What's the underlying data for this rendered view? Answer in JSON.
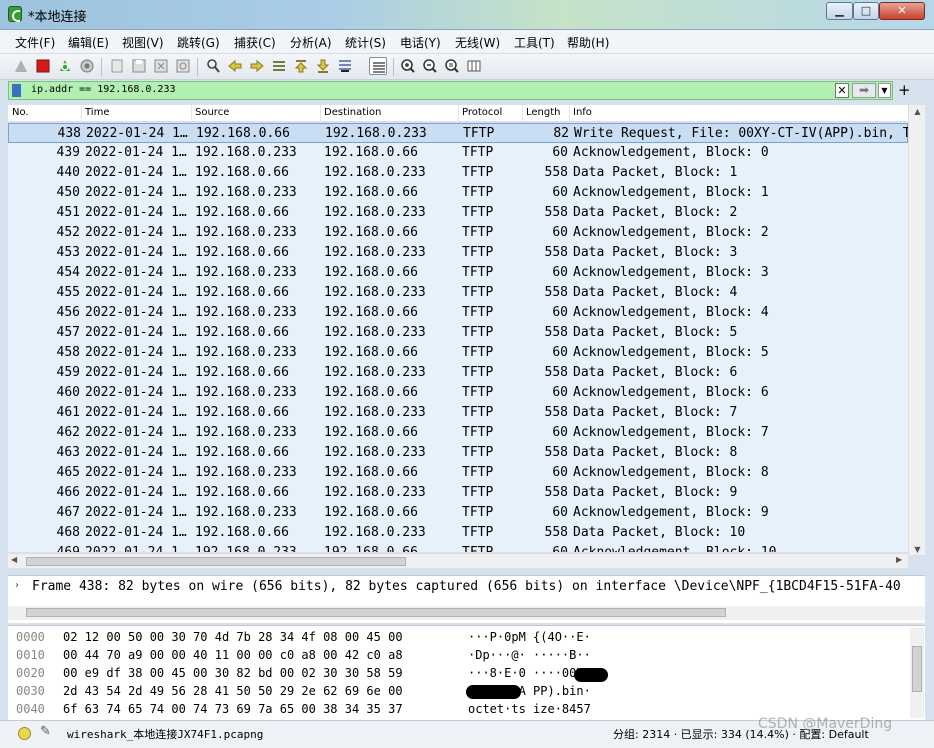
{
  "window": {
    "title": "*本地连接",
    "min": "▁",
    "max": "□",
    "close": "✕"
  },
  "menu": [
    "文件(F)",
    "编辑(E)",
    "视图(V)",
    "跳转(G)",
    "捕获(C)",
    "分析(A)",
    "统计(S)",
    "电话(Y)",
    "无线(W)",
    "工具(T)",
    "帮助(H)"
  ],
  "filter": {
    "text": "ip.addr == 192.168.0.233",
    "clear": "✕",
    "apply": "➡",
    "dropdown": "▼",
    "add": "+"
  },
  "columns": [
    "No.",
    "Time",
    "Source",
    "Destination",
    "Protocol",
    "Length",
    "Info"
  ],
  "packets": [
    {
      "no": "438",
      "time": "2022-01-24 1…",
      "src": "192.168.0.66",
      "dst": "192.168.0.233",
      "proto": "TFTP",
      "len": "82",
      "info": "Write Request, File: 00XY-CT-IV(APP).bin, T"
    },
    {
      "no": "439",
      "time": "2022-01-24 1…",
      "src": "192.168.0.233",
      "dst": "192.168.0.66",
      "proto": "TFTP",
      "len": "60",
      "info": "Acknowledgement, Block: 0"
    },
    {
      "no": "440",
      "time": "2022-01-24 1…",
      "src": "192.168.0.66",
      "dst": "192.168.0.233",
      "proto": "TFTP",
      "len": "558",
      "info": "Data Packet, Block: 1"
    },
    {
      "no": "450",
      "time": "2022-01-24 1…",
      "src": "192.168.0.233",
      "dst": "192.168.0.66",
      "proto": "TFTP",
      "len": "60",
      "info": "Acknowledgement, Block: 1"
    },
    {
      "no": "451",
      "time": "2022-01-24 1…",
      "src": "192.168.0.66",
      "dst": "192.168.0.233",
      "proto": "TFTP",
      "len": "558",
      "info": "Data Packet, Block: 2"
    },
    {
      "no": "452",
      "time": "2022-01-24 1…",
      "src": "192.168.0.233",
      "dst": "192.168.0.66",
      "proto": "TFTP",
      "len": "60",
      "info": "Acknowledgement, Block: 2"
    },
    {
      "no": "453",
      "time": "2022-01-24 1…",
      "src": "192.168.0.66",
      "dst": "192.168.0.233",
      "proto": "TFTP",
      "len": "558",
      "info": "Data Packet, Block: 3"
    },
    {
      "no": "454",
      "time": "2022-01-24 1…",
      "src": "192.168.0.233",
      "dst": "192.168.0.66",
      "proto": "TFTP",
      "len": "60",
      "info": "Acknowledgement, Block: 3"
    },
    {
      "no": "455",
      "time": "2022-01-24 1…",
      "src": "192.168.0.66",
      "dst": "192.168.0.233",
      "proto": "TFTP",
      "len": "558",
      "info": "Data Packet, Block: 4"
    },
    {
      "no": "456",
      "time": "2022-01-24 1…",
      "src": "192.168.0.233",
      "dst": "192.168.0.66",
      "proto": "TFTP",
      "len": "60",
      "info": "Acknowledgement, Block: 4"
    },
    {
      "no": "457",
      "time": "2022-01-24 1…",
      "src": "192.168.0.66",
      "dst": "192.168.0.233",
      "proto": "TFTP",
      "len": "558",
      "info": "Data Packet, Block: 5"
    },
    {
      "no": "458",
      "time": "2022-01-24 1…",
      "src": "192.168.0.233",
      "dst": "192.168.0.66",
      "proto": "TFTP",
      "len": "60",
      "info": "Acknowledgement, Block: 5"
    },
    {
      "no": "459",
      "time": "2022-01-24 1…",
      "src": "192.168.0.66",
      "dst": "192.168.0.233",
      "proto": "TFTP",
      "len": "558",
      "info": "Data Packet, Block: 6"
    },
    {
      "no": "460",
      "time": "2022-01-24 1…",
      "src": "192.168.0.233",
      "dst": "192.168.0.66",
      "proto": "TFTP",
      "len": "60",
      "info": "Acknowledgement, Block: 6"
    },
    {
      "no": "461",
      "time": "2022-01-24 1…",
      "src": "192.168.0.66",
      "dst": "192.168.0.233",
      "proto": "TFTP",
      "len": "558",
      "info": "Data Packet, Block: 7"
    },
    {
      "no": "462",
      "time": "2022-01-24 1…",
      "src": "192.168.0.233",
      "dst": "192.168.0.66",
      "proto": "TFTP",
      "len": "60",
      "info": "Acknowledgement, Block: 7"
    },
    {
      "no": "463",
      "time": "2022-01-24 1…",
      "src": "192.168.0.66",
      "dst": "192.168.0.233",
      "proto": "TFTP",
      "len": "558",
      "info": "Data Packet, Block: 8"
    },
    {
      "no": "465",
      "time": "2022-01-24 1…",
      "src": "192.168.0.233",
      "dst": "192.168.0.66",
      "proto": "TFTP",
      "len": "60",
      "info": "Acknowledgement, Block: 8"
    },
    {
      "no": "466",
      "time": "2022-01-24 1…",
      "src": "192.168.0.66",
      "dst": "192.168.0.233",
      "proto": "TFTP",
      "len": "558",
      "info": "Data Packet, Block: 9"
    },
    {
      "no": "467",
      "time": "2022-01-24 1…",
      "src": "192.168.0.233",
      "dst": "192.168.0.66",
      "proto": "TFTP",
      "len": "60",
      "info": "Acknowledgement, Block: 9"
    },
    {
      "no": "468",
      "time": "2022-01-24 1…",
      "src": "192.168.0.66",
      "dst": "192.168.0.233",
      "proto": "TFTP",
      "len": "558",
      "info": "Data Packet, Block: 10"
    },
    {
      "no": "469",
      "time": "2022-01-24 1…",
      "src": "192.168.0.233",
      "dst": "192.168.0.66",
      "proto": "TFTP",
      "len": "60",
      "info": "Acknowledgement, Block: 10"
    }
  ],
  "details": {
    "expand": "›",
    "text": "Frame 438: 82 bytes on wire (656 bits), 82 bytes captured (656 bits) on interface \\Device\\NPF_{1BCD4F15-51FA-40"
  },
  "bytes": [
    {
      "off": "0000",
      "hex": "02 12 00 50 00 30 70 4d  7b 28 34 4f 08 00 45 00",
      "ascii": "···P·0pM {(4O··E·"
    },
    {
      "off": "0010",
      "hex": "00 44 70 a9 00 00 40 11  00 00 c0 a8 00 42 c0 a8",
      "ascii": "·Dp···@· ·····B··"
    },
    {
      "off": "0020",
      "hex": "00 e9 df 38 00 45 00 30  82 bd 00 02 30 30 58 59",
      "ascii": "···8·E·0 ····00XY"
    },
    {
      "off": "0030",
      "hex": "2d 43 54 2d 49 56 28 41  50 50 29 2e 62 69 6e 00",
      "ascii": "-CT-IV(A PP).bin·"
    },
    {
      "off": "0040",
      "hex": "6f 63 74 65 74 00 74 73  69 7a 65 00 38 34 35 37",
      "ascii": "octet·ts ize·8457"
    }
  ],
  "status": {
    "file": "wireshark_本地连接JX74F1.pcapng",
    "stats": "分组: 2314 · 已显示: 334 (14.4%) · 配置: Default",
    "watermark": "CSDN @MaverDing"
  },
  "colors": {
    "filter_bg": "#b2f0b1",
    "row_bg": "#e6f1fb",
    "selected_row_bg": "#c9def3"
  }
}
